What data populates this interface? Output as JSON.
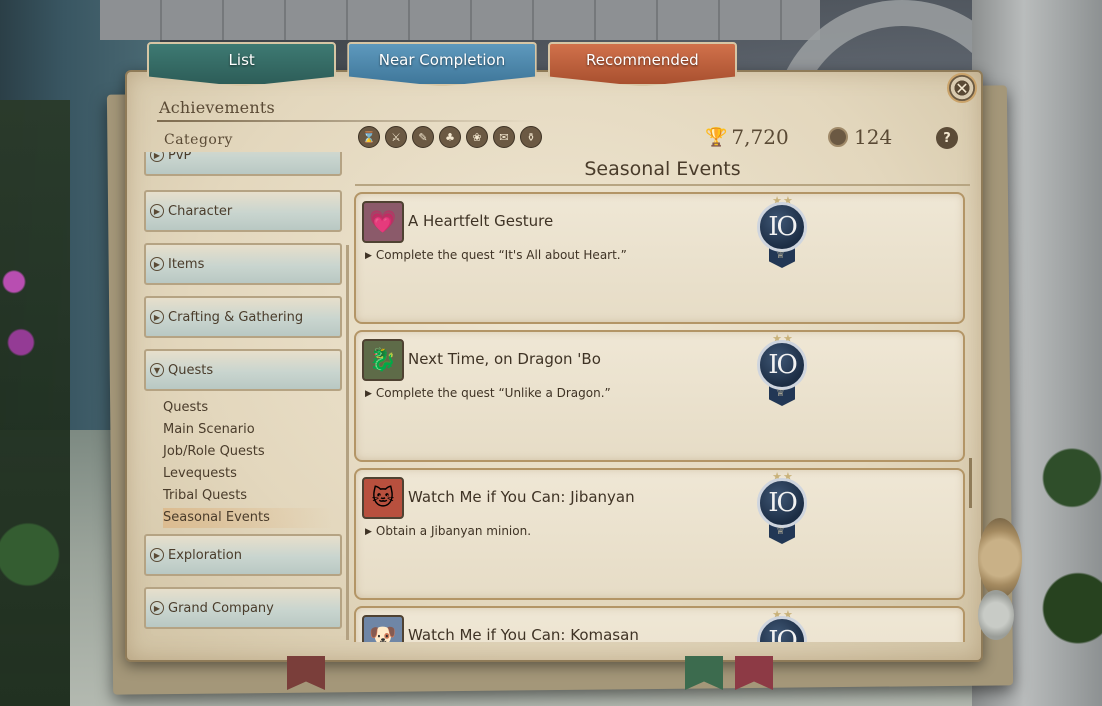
{
  "tabs": [
    {
      "label": "List"
    },
    {
      "label": "Near Completion"
    },
    {
      "label": "Recommended"
    }
  ],
  "header": {
    "title": "Achievements",
    "category_label": "Category",
    "points": "7,720",
    "rewards_count": "124"
  },
  "filter_icons": [
    "all-icon",
    "battle-icon",
    "character-icon",
    "items-icon",
    "crafting-icon",
    "quests-icon",
    "exploration-icon"
  ],
  "section_title": "Seasonal Events",
  "sidebar": {
    "categories": [
      {
        "label": "PvP"
      },
      {
        "label": "Character"
      },
      {
        "label": "Items"
      },
      {
        "label": "Crafting & Gathering"
      },
      {
        "label": "Quests"
      },
      {
        "label": "Exploration"
      },
      {
        "label": "Grand Company"
      }
    ],
    "quest_subitems": [
      {
        "label": "Quests"
      },
      {
        "label": "Main Scenario"
      },
      {
        "label": "Job/Role Quests"
      },
      {
        "label": "Levequests"
      },
      {
        "label": "Tribal Quests"
      },
      {
        "label": "Seasonal Events"
      }
    ],
    "selected_subitem": "Seasonal Events"
  },
  "achievements": [
    {
      "name": "A Heartfelt Gesture",
      "description": "Complete the quest “It's All about Heart.”",
      "points": "IO",
      "stars": "★★",
      "icon": "heart-chair-icon"
    },
    {
      "name": "Next Time, on Dragon 'Bo",
      "description": "Complete the quest “Unlike a Dragon.”",
      "points": "IO",
      "stars": "★★",
      "icon": "dragon-icon"
    },
    {
      "name": "Watch Me if You Can: Jibanyan",
      "description": "Obtain a Jibanyan minion.",
      "points": "IO",
      "stars": "★★",
      "icon": "jibanyan-icon"
    },
    {
      "name": "Watch Me if You Can: Komasan",
      "description": "",
      "points": "IO",
      "stars": "★★",
      "icon": "komasan-icon"
    }
  ],
  "colors": {
    "tab_list": "#3e7a73",
    "tab_near": "#5e99bd",
    "tab_recommended": "#d1714b",
    "parchment": "#e6dcc6",
    "medal": "#1c2d44"
  }
}
